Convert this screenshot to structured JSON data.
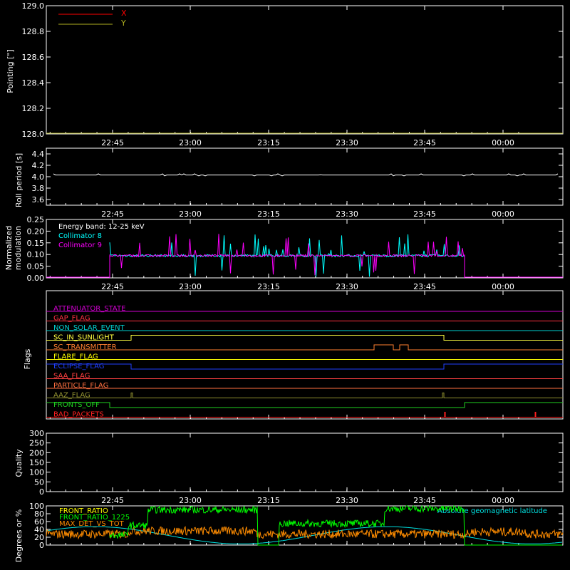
{
  "colors": {
    "background": "#000000",
    "axes": "#ffffff",
    "x_series": "#ff0000",
    "y_series": "#b0b020",
    "collimator8": "#00ffff",
    "collimator9": "#ff00ff",
    "front_ratio": "#ffff00",
    "front_ratio_1225": "#00ff00",
    "max_det": "#ff8c00",
    "geomag": "#00e0e0"
  },
  "time_ticks": [
    "22:45",
    "23:00",
    "23:15",
    "23:30",
    "23:45",
    "00:00"
  ],
  "chart_data": [
    {
      "name": "pointing",
      "type": "line",
      "ylabel": "Pointing [\"]",
      "ylim": [
        128.0,
        129.0
      ],
      "yticks": [
        "128.0",
        "128.2",
        "128.4",
        "128.6",
        "128.8",
        "129.0"
      ],
      "legend": [
        {
          "label": "X",
          "color": "#ff0000"
        },
        {
          "label": "Y",
          "color": "#b0b020"
        }
      ],
      "legend_position": "top-left",
      "series": [
        {
          "values_constant": 128.0
        }
      ]
    },
    {
      "name": "roll_period",
      "type": "line",
      "ylabel": "Roll period [s]",
      "ylim": [
        3.5,
        4.5
      ],
      "yticks": [
        "3.6",
        "3.8",
        "4.0",
        "4.2",
        "4.4"
      ],
      "series": [
        {
          "values_constant": 4.03
        }
      ]
    },
    {
      "name": "modulation",
      "type": "line",
      "ylabel": "Normalized modulation",
      "ylim": [
        0.0,
        0.25
      ],
      "yticks": [
        "0.00",
        "0.05",
        "0.10",
        "0.15",
        "0.20",
        "0.25"
      ],
      "annotations": [
        "Energy band: 12-25 keV"
      ],
      "legend": [
        {
          "label": "Collimator 8",
          "color": "#00ffff"
        },
        {
          "label": "Collimator 9",
          "color": "#ff00ff"
        }
      ],
      "legend_position": "top-left",
      "active_range": [
        "22:45",
        "23:52"
      ],
      "baseline": 0.1
    },
    {
      "name": "flags",
      "type": "line",
      "ylabel": "Flags",
      "flags": [
        {
          "label": "ATTENUATOR_STATE",
          "color": "#d000d0"
        },
        {
          "label": "GAP_FLAG",
          "color": "#ff3040"
        },
        {
          "label": "NON_SOLAR_EVENT",
          "color": "#00d0d0"
        },
        {
          "label": "SC_IN_SUNLIGHT",
          "color": "#ffff40"
        },
        {
          "label": "SC_TRANSMITTER",
          "color": "#ff8030"
        },
        {
          "label": "FLARE_FLAG",
          "color": "#ffff00"
        },
        {
          "label": "ECLIPSE_FLAG",
          "color": "#2040ff"
        },
        {
          "label": "SAA_FLAG",
          "color": "#ff4040"
        },
        {
          "label": "PARTICLE_FLAG",
          "color": "#ff7040"
        },
        {
          "label": "AAZ_FLAG",
          "color": "#909030"
        },
        {
          "label": "FRONTS_OFF",
          "color": "#20d020"
        },
        {
          "label": "BAD_PACKETS",
          "color": "#ff2020"
        }
      ]
    },
    {
      "name": "quality",
      "type": "line",
      "ylabel": "Quality",
      "ylim": [
        0,
        300
      ],
      "yticks": [
        "0",
        "50",
        "100",
        "150",
        "200",
        "250",
        "300"
      ]
    },
    {
      "name": "front_ratio",
      "type": "line",
      "ylabel": "Degrees or %",
      "ylim": [
        0,
        100
      ],
      "yticks": [
        "0",
        "20",
        "40",
        "60",
        "80",
        "100"
      ],
      "legend": [
        {
          "label": "FRONT_RATIO",
          "color": "#ffff00"
        },
        {
          "label": "FRONT_RATIO_1225",
          "color": "#00ff00"
        },
        {
          "label": "MAX_DET_VS_TOT",
          "color": "#ff8c00"
        }
      ],
      "annotations": [
        "Absolute geomagnetic latitude"
      ]
    }
  ]
}
